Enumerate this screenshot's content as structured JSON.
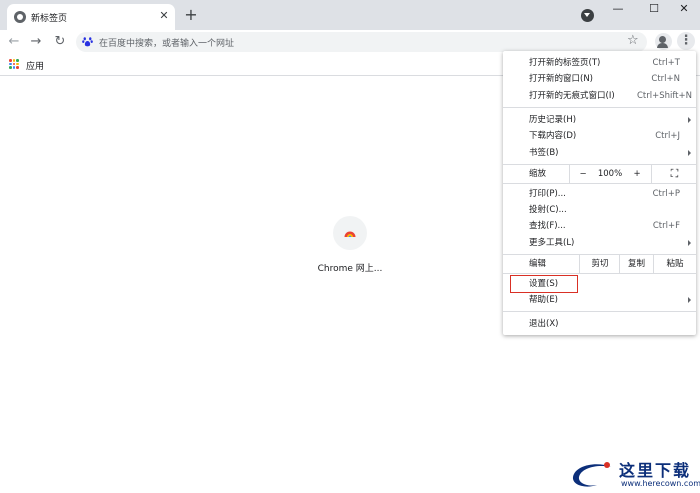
{
  "tab": {
    "title": "新标签页",
    "close_glyph": "✕"
  },
  "new_tab_glyph": "+",
  "window": {
    "minimize": "—",
    "maximize": "☐",
    "close": "✕"
  },
  "toolbar": {
    "back_glyph": "←",
    "forward_glyph": "→",
    "reload_glyph": "↻",
    "omnibox_placeholder": "在百度中搜索，或者输入一个网址",
    "star_glyph": "☆",
    "menu_glyph": "⋮"
  },
  "bookmarks": {
    "apps_label": "应用"
  },
  "shortcut": {
    "label": "Chrome 网上..."
  },
  "menu": {
    "new_tab": {
      "label": "打开新的标签页(T)",
      "shortcut": "Ctrl+T"
    },
    "new_window": {
      "label": "打开新的窗口(N)",
      "shortcut": "Ctrl+N"
    },
    "incognito": {
      "label": "打开新的无痕式窗口(I)",
      "shortcut": "Ctrl+Shift+N"
    },
    "history": {
      "label": "历史记录(H)"
    },
    "downloads": {
      "label": "下载内容(D)",
      "shortcut": "Ctrl+J"
    },
    "bookmarks": {
      "label": "书签(B)"
    },
    "zoom": {
      "label": "缩放",
      "minus": "−",
      "value": "100%",
      "plus": "+",
      "fullscreen": "⛶"
    },
    "print": {
      "label": "打印(P)...",
      "shortcut": "Ctrl+P"
    },
    "cast": {
      "label": "投射(C)..."
    },
    "find": {
      "label": "查找(F)...",
      "shortcut": "Ctrl+F"
    },
    "more_tools": {
      "label": "更多工具(L)"
    },
    "edit": {
      "label": "编辑",
      "cut": "剪切",
      "copy": "复制",
      "paste": "粘贴"
    },
    "settings": {
      "label": "设置(S)"
    },
    "help": {
      "label": "帮助(E)"
    },
    "exit": {
      "label": "退出(X)"
    }
  },
  "watermark": {
    "text": "这里下载",
    "url": "www.herecown.com"
  },
  "colors": {
    "highlight": "#d93025",
    "tabstrip": "#dee1e6",
    "watermark": "#0c2f7a"
  }
}
